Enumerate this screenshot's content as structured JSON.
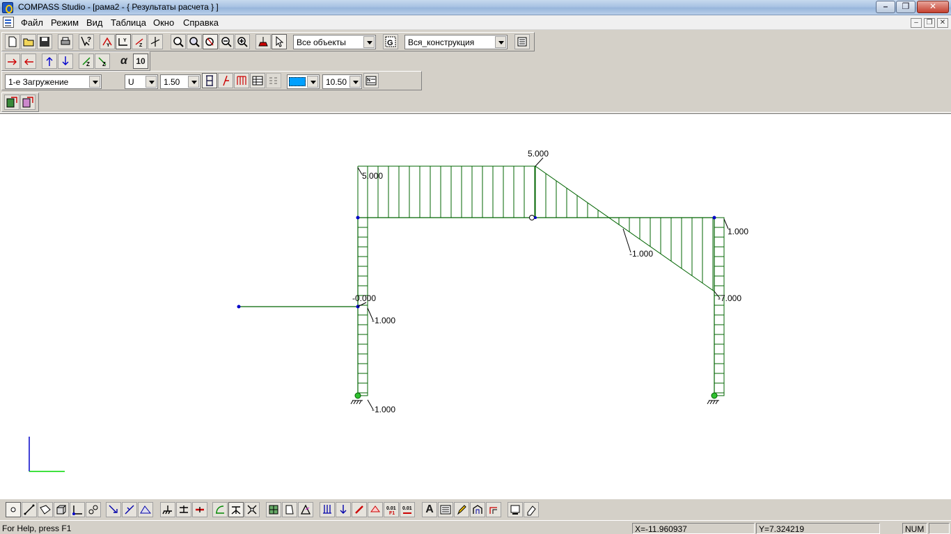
{
  "window": {
    "title": "COMPASS  Studio - [рама2 - { Результаты расчета } ]",
    "ghost_title": "",
    "controls": [
      "minimize-icon",
      "maximize-icon",
      "close-icon"
    ]
  },
  "menu": {
    "items": [
      {
        "label": "Файл"
      },
      {
        "label": "Режим"
      },
      {
        "label": "Вид"
      },
      {
        "label": "Таблица"
      },
      {
        "label": "Окно"
      },
      {
        "label": "Справка"
      }
    ]
  },
  "toolbar": {
    "objects_filter": "Все объекты",
    "construction": "Вся_конструкция",
    "alpha_label": "α",
    "alpha_value": "10",
    "load_case": "1-е Загружение",
    "result_type": "U",
    "scale": "1.50",
    "font_size": "10.50",
    "color_accent": "#00a0ff"
  },
  "diagram": {
    "line_color": "#006400",
    "node_color": "#0000c8",
    "axis_x_color": "#00d800",
    "axis_y_color": "#0000c8",
    "labels": {
      "top_peak": "5.000",
      "left_top": "5.000",
      "right_top": "1.000",
      "crossing": "-1.000",
      "right_low": "-7.000",
      "left_mid": "-0.000",
      "left_mid2": "-1.000",
      "left_base": "-1.000"
    }
  },
  "status": {
    "help": "For Help, press F1",
    "x": "X=-11.960937",
    "y": "Y=7.324219",
    "num": "NUM"
  }
}
